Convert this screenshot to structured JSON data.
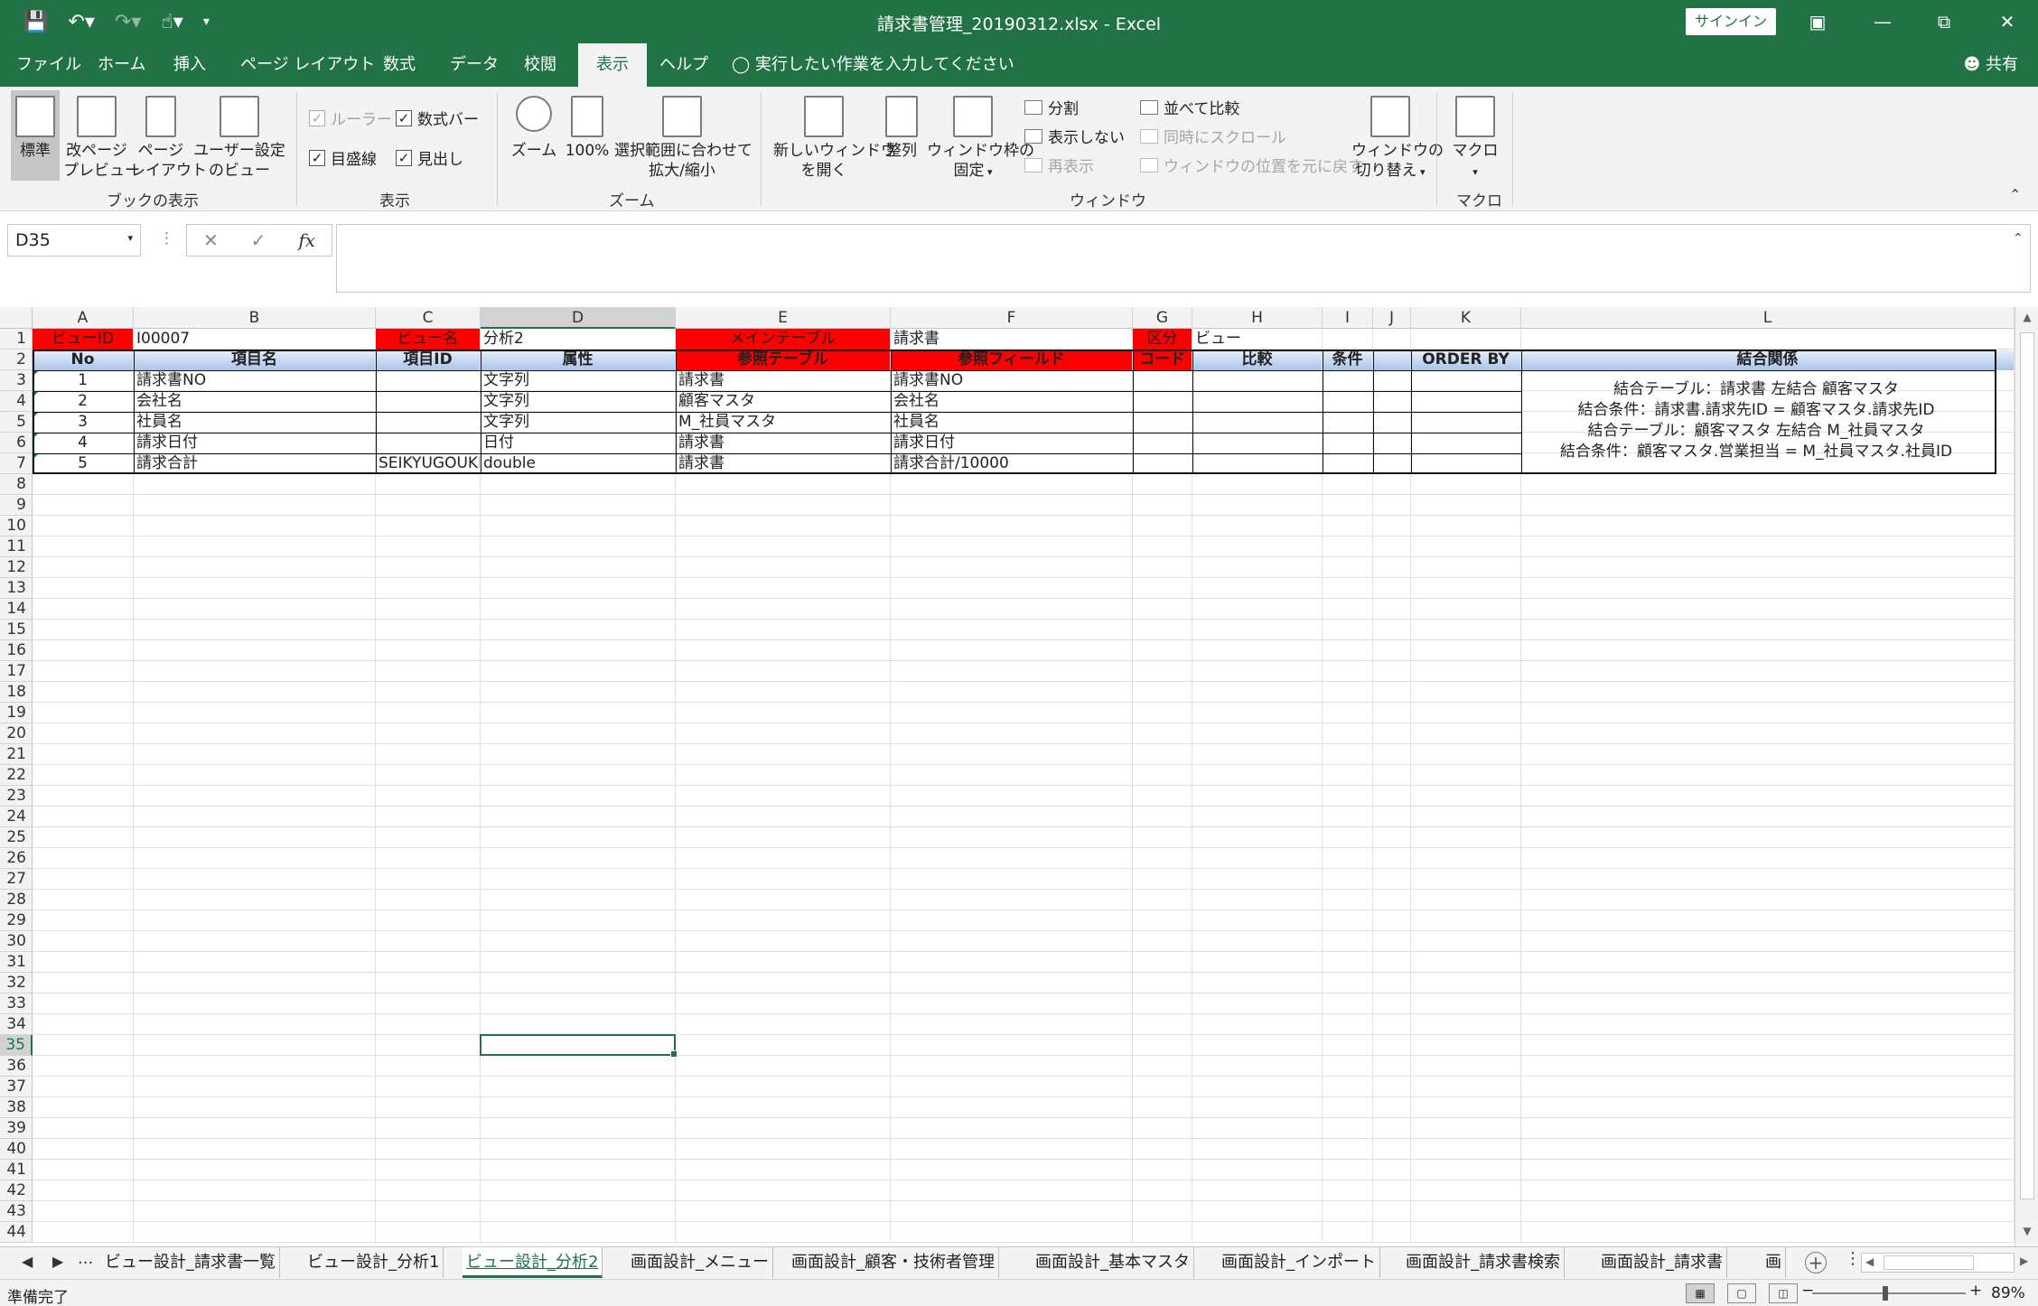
{
  "window": {
    "title": "請求書管理_20190312.xlsx  -  Excel",
    "signin_label": "サインイン",
    "qat_icons": [
      "save-icon",
      "undo-icon",
      "redo-icon",
      "touch-mode-icon",
      "customize-icon"
    ]
  },
  "menu": {
    "tabs": [
      "ファイル",
      "ホーム",
      "挿入",
      "ページ レイアウト",
      "数式",
      "データ",
      "校閲",
      "表示",
      "ヘルプ"
    ],
    "active_tab": "表示",
    "tell_me": "実行したい作業を入力してください",
    "share": "共有"
  },
  "ribbon": {
    "book_view": {
      "label": "ブックの表示",
      "normal": "標準",
      "page_break_1": "改ページ",
      "page_break_2": "プレビュー",
      "page_layout_1": "ページ",
      "page_layout_2": "レイアウト",
      "custom_1": "ユーザー設定",
      "custom_2": "のビュー"
    },
    "show": {
      "label": "表示",
      "ruler": "ルーラー",
      "formula_bar": "数式バー",
      "gridlines": "目盛線",
      "headings": "見出し"
    },
    "zoom": {
      "label": "ズーム",
      "zoom": "ズーム",
      "hundred": "100%",
      "selection_1": "選択範囲に合わせて",
      "selection_2": "拡大/縮小"
    },
    "window": {
      "label": "ウィンドウ",
      "new_window_1": "新しいウィンドウ",
      "new_window_2": "を開く",
      "arrange": "整列",
      "freeze_1": "ウィンドウ枠の",
      "freeze_2": "固定",
      "split": "分割",
      "hide": "表示しない",
      "unhide": "再表示",
      "side_by_side": "並べて比較",
      "sync_scroll": "同時にスクロール",
      "reset_position": "ウィンドウの位置を元に戻す",
      "switch_1": "ウィンドウの",
      "switch_2": "切り替え"
    },
    "macros": {
      "label": "マクロ",
      "macros": "マクロ"
    }
  },
  "formula_bar": {
    "name_box": "D35",
    "fx": "fx",
    "content": ""
  },
  "grid": {
    "columns": [
      "A",
      "B",
      "C",
      "D",
      "E",
      "F",
      "G",
      "H",
      "I",
      "J",
      "K",
      "L"
    ],
    "selected_column": "D",
    "selected_row": 35,
    "row_count": 44,
    "row1": {
      "view_id_label": "ビューID",
      "view_id": "I00007",
      "view_name_label": "ビュー名",
      "view_name": "分析2",
      "main_table_label": "メインテーブル",
      "main_table": "請求書",
      "kind_label": "区分",
      "kind": "ビュー"
    },
    "headers": [
      "No",
      "項目名",
      "項目ID",
      "属性",
      "参照テーブル",
      "参照フィールド",
      "コード",
      "比較",
      "条件",
      "",
      "ORDER BY",
      "結合関係"
    ],
    "rows": [
      {
        "no": "1",
        "name": "請求書NO",
        "id": "",
        "type": "文字列",
        "ref_table": "請求書",
        "ref_field": "請求書NO"
      },
      {
        "no": "2",
        "name": "会社名",
        "id": "",
        "type": "文字列",
        "ref_table": "顧客マスタ",
        "ref_field": "会社名"
      },
      {
        "no": "3",
        "name": "社員名",
        "id": "",
        "type": "文字列",
        "ref_table": "M_社員マスタ",
        "ref_field": "社員名"
      },
      {
        "no": "4",
        "name": "請求日付",
        "id": "",
        "type": "日付",
        "ref_table": "請求書",
        "ref_field": "請求日付"
      },
      {
        "no": "5",
        "name": "請求合計",
        "id": "SEIKYUGOUKEI",
        "type": "double",
        "ref_table": "請求書",
        "ref_field": "請求合計/10000"
      }
    ],
    "join_lines": [
      "結合テーブル：請求書 左結合 顧客マスタ",
      "結合条件：請求書.請求先ID = 顧客マスタ.請求先ID",
      "結合テーブル：顧客マスタ 左結合 M_社員マスタ",
      "結合条件：顧客マスタ.営業担当 = M_社員マスタ.社員ID"
    ]
  },
  "sheets": {
    "tabs": [
      "ビュー設計_請求書一覧",
      "ビュー設計_分析1",
      "ビュー設計_分析2",
      "画面設計_メニュー",
      "画面設計_顧客・技術者管理",
      "画面設計_基本マスタ",
      "画面設計_インポート",
      "画面設計_請求書検索",
      "画面設計_請求書",
      "画"
    ],
    "active": "ビュー設計_分析2",
    "more": "..."
  },
  "status": {
    "text": "準備完了",
    "zoom": "89%"
  },
  "colors": {
    "excel_green": "#217346",
    "header_red": "#ff0000",
    "header_blue": "#a9c4ea"
  }
}
